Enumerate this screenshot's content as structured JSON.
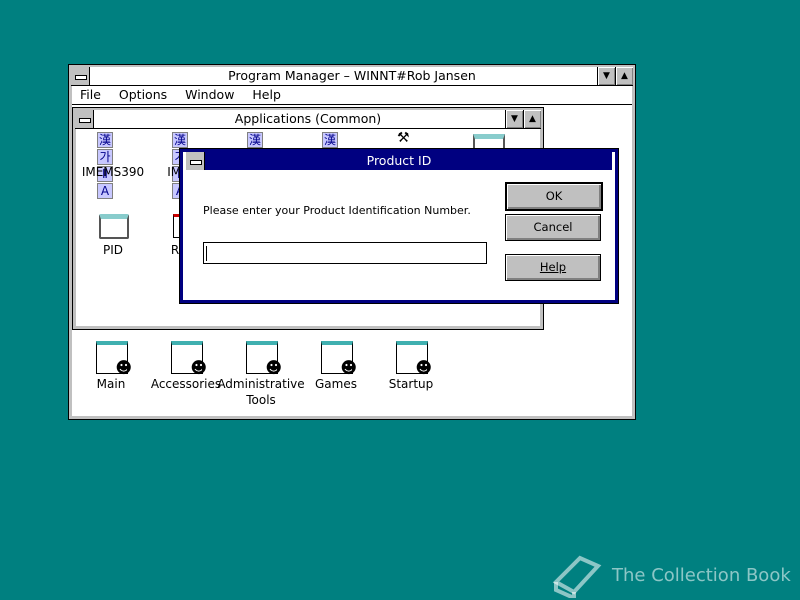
{
  "program_manager": {
    "title": "Program Manager – WINNT#Rob Jansen",
    "menu": [
      "File",
      "Options",
      "Window",
      "Help"
    ]
  },
  "applications": {
    "title": "Applications (Common)",
    "icons": [
      {
        "label": "IMEMS390"
      },
      {
        "label": "IME"
      },
      {
        "label": ""
      },
      {
        "label": ""
      },
      {
        "label": ""
      },
      {
        "label": ""
      },
      {
        "label": "PID"
      },
      {
        "label": "R"
      }
    ]
  },
  "groups": [
    {
      "label": "Main"
    },
    {
      "label": "Accessories"
    },
    {
      "label": "Administrative Tools"
    },
    {
      "label": "Games"
    },
    {
      "label": "Startup"
    }
  ],
  "dialog": {
    "title": "Product ID",
    "prompt": "Please enter your Product Identification Number.",
    "input_value": "",
    "ok": "OK",
    "cancel": "Cancel",
    "help": "Help"
  },
  "watermark": {
    "text": "The Collection Book"
  },
  "colors": {
    "desktop": "#008080",
    "active_title": "#000080",
    "button_face": "#c0c0c0"
  }
}
